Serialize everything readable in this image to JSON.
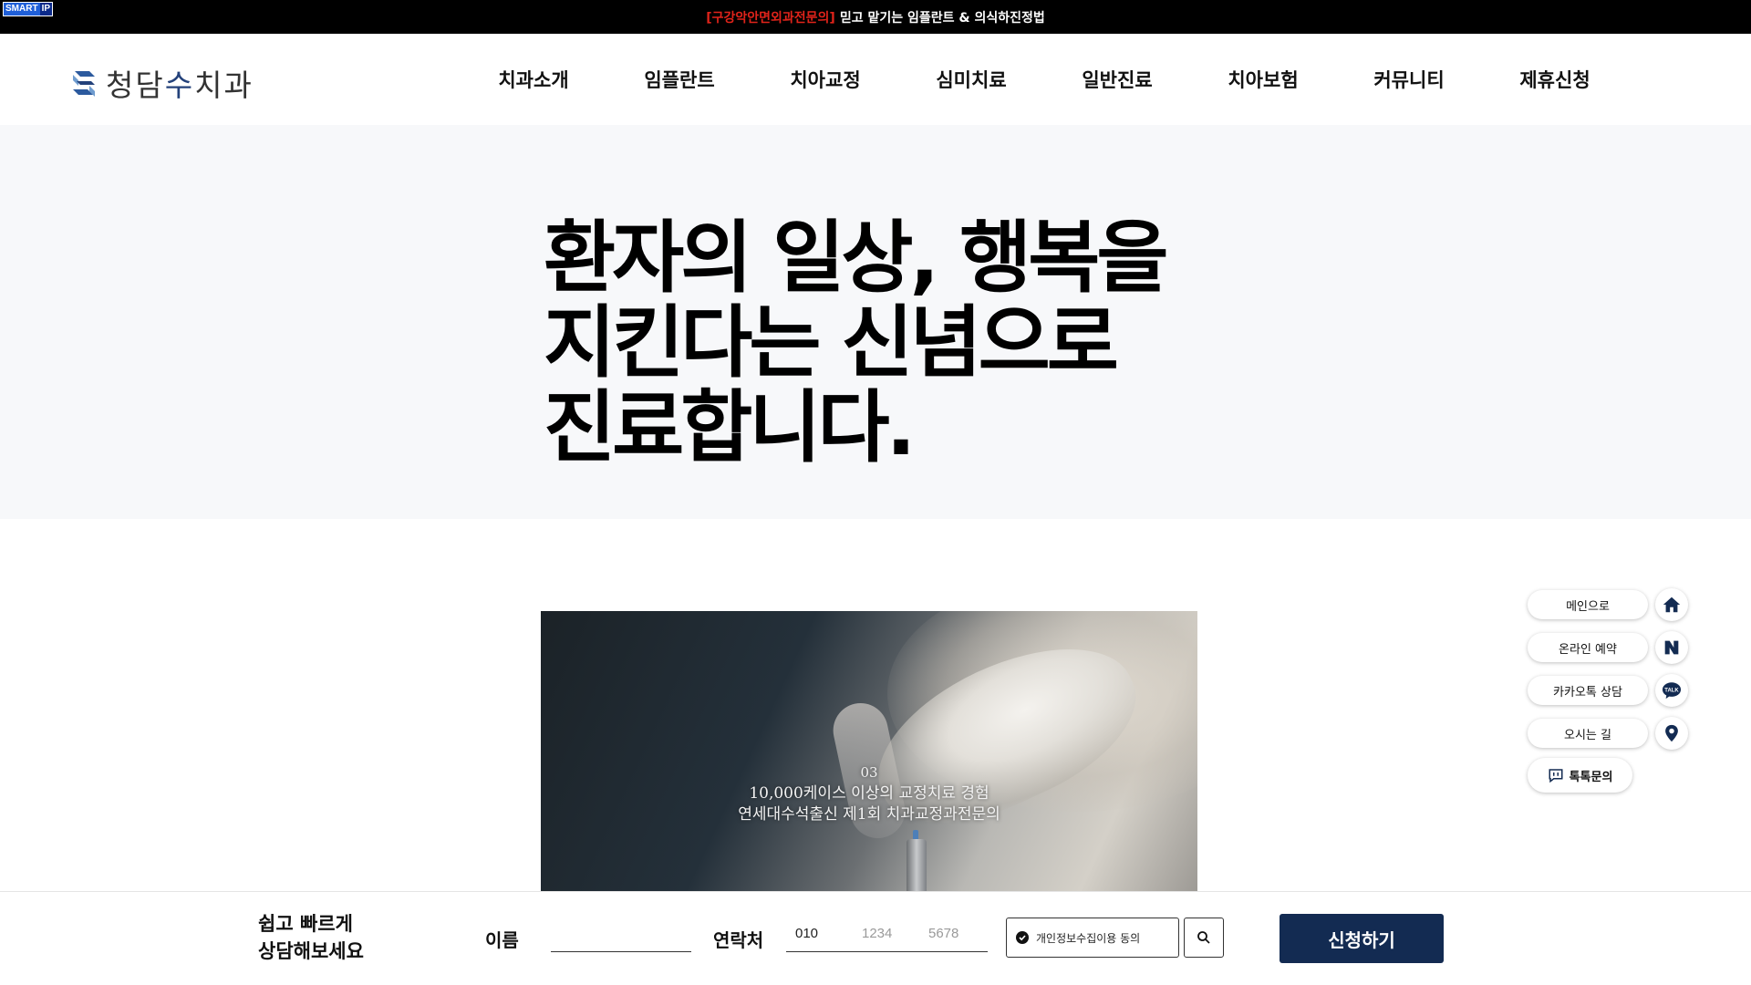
{
  "topbar": {
    "badge_a": "SMART",
    "badge_b": "IP",
    "highlight": "[구강악안면외과전문의]",
    "text": "믿고 맡기는 임플란트 & 의식하진정법"
  },
  "header": {
    "logo_pre": "청담",
    "logo_accent": "수",
    "logo_post": "치과",
    "nav": [
      "치과소개",
      "임플란트",
      "치아교정",
      "심미치료",
      "일반진료",
      "치아보험",
      "커뮤니티",
      "제휴신청"
    ]
  },
  "hero": {
    "lines": [
      "환자의 일상, 행복을",
      "지킨다는 신념으로",
      "진료합니다."
    ]
  },
  "video": {
    "number": "03",
    "line1": "10,000케이스 이상의 교정치료 경험",
    "line2": "연세대수석출신 제1회 치과교정과전문의"
  },
  "quick_menu": {
    "items": [
      {
        "label": "메인으로",
        "icon": "home-icon"
      },
      {
        "label": "온라인 예약",
        "icon": "naver-icon"
      },
      {
        "label": "카카오톡 상담",
        "icon": "kakao-talk-icon"
      },
      {
        "label": "오시는 길",
        "icon": "map-pin-icon"
      }
    ],
    "talk_label": "톡톡문의",
    "kakao_text": "TALK"
  },
  "consult": {
    "title_line1": "쉽고 빠르게",
    "title_line2": "상담해보세요",
    "name_label": "이름",
    "phone_label": "연락처",
    "phone1_value": "010",
    "phone2_placeholder": "1234",
    "phone3_placeholder": "5678",
    "agree_label": "개인정보수집이용 동의",
    "submit_label": "신청하기"
  },
  "colors": {
    "brand_navy": "#132b52",
    "topbar_red": "#e0231a",
    "hero_bg": "#f7f8fa"
  }
}
